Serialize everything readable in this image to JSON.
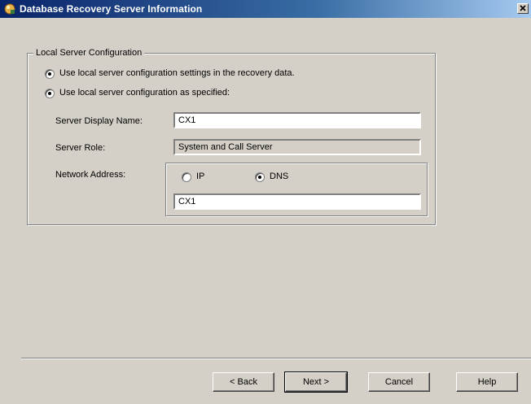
{
  "window": {
    "title": "Database Recovery Server Information",
    "close_glyph": "×"
  },
  "group": {
    "legend": "Local Server Configuration",
    "options": [
      {
        "label": "Use local server configuration settings in the recovery data.",
        "checked": true
      },
      {
        "label": "Use local server configuration as specified:",
        "checked": true
      }
    ]
  },
  "fields": {
    "server_display_name": {
      "label": "Server Display Name:",
      "value": "CX1"
    },
    "server_role": {
      "label": "Server Role:",
      "value": "System and Call Server"
    },
    "network_address": {
      "label": "Network Address:",
      "value": "CX1"
    }
  },
  "network": {
    "ip_label": "IP",
    "ip_checked": false,
    "dns_label": "DNS",
    "dns_checked": true
  },
  "buttons": {
    "back": "< Back",
    "next": "Next >",
    "cancel": "Cancel",
    "help": "Help"
  }
}
